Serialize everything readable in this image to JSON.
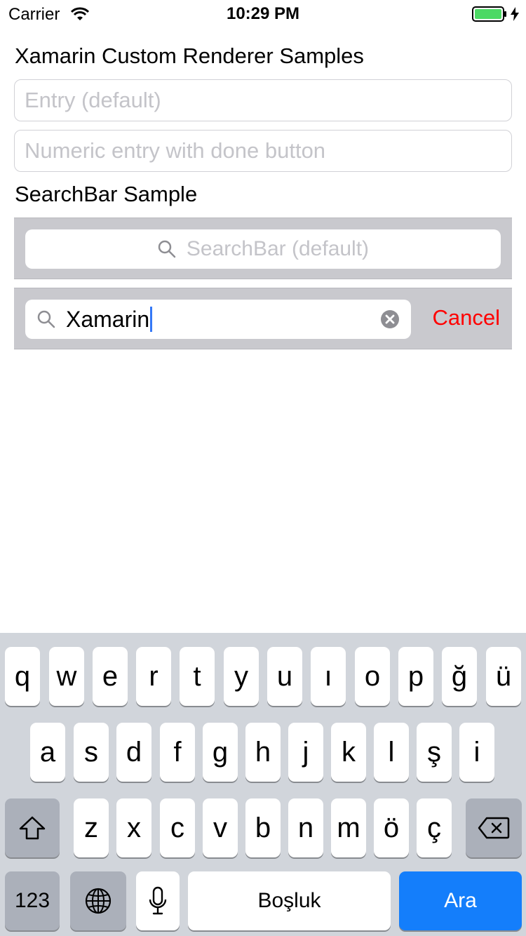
{
  "status_bar": {
    "carrier": "Carrier",
    "time": "10:29 PM",
    "battery_color": "#4cd964"
  },
  "page": {
    "title": "Xamarin Custom Renderer Samples",
    "entry_default_placeholder": "Entry (default)",
    "entry_numeric_placeholder": "Numeric entry with done button",
    "searchbar_section_title": "SearchBar Sample"
  },
  "searchbar_default": {
    "placeholder": "SearchBar (default)",
    "icon": "search-icon"
  },
  "searchbar_active": {
    "value": "Xamarin",
    "cancel_label": "Cancel",
    "cancel_color": "#ff0000",
    "icon": "search-icon",
    "clear_icon": "clear-icon"
  },
  "keyboard": {
    "row1": [
      "q",
      "w",
      "e",
      "r",
      "t",
      "y",
      "u",
      "ı",
      "o",
      "p",
      "ğ",
      "ü"
    ],
    "row2": [
      "a",
      "s",
      "d",
      "f",
      "g",
      "h",
      "j",
      "k",
      "l",
      "ş",
      "i"
    ],
    "row3": [
      "z",
      "x",
      "c",
      "v",
      "b",
      "n",
      "m",
      "ö",
      "ç"
    ],
    "shift_icon": "shift-icon",
    "delete_icon": "delete-icon",
    "numbers_label": "123",
    "globe_icon": "globe-icon",
    "mic_icon": "microphone-icon",
    "space_label": "Boşluk",
    "return_label": "Ara",
    "return_color": "#147efb"
  }
}
